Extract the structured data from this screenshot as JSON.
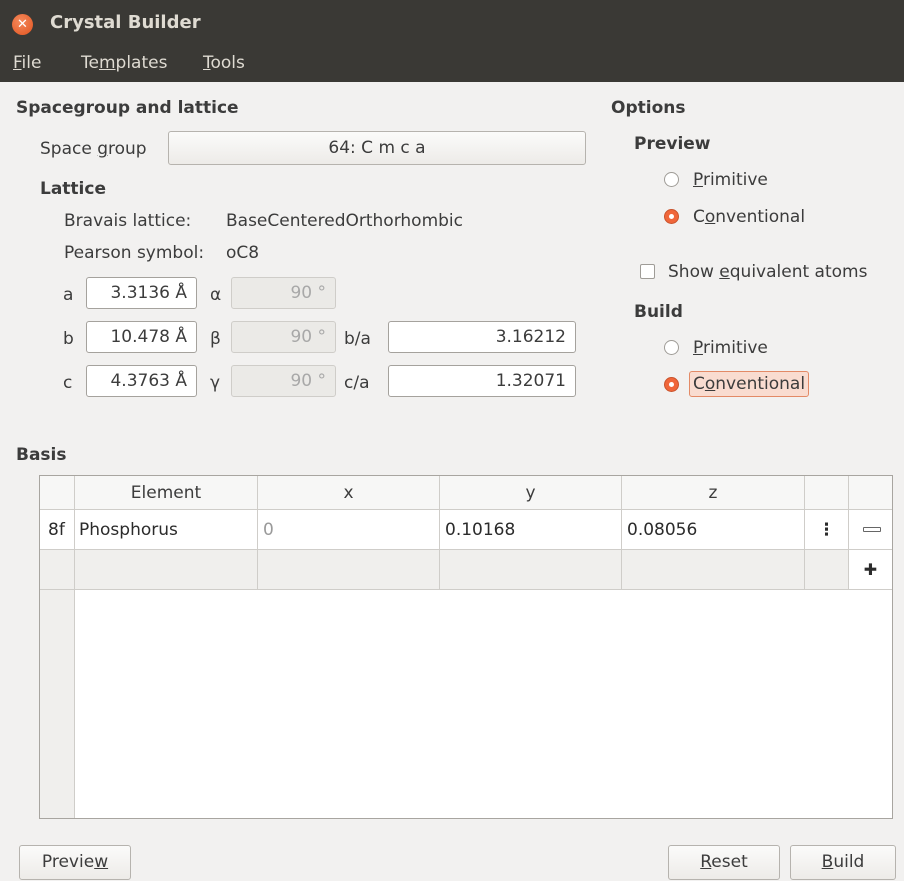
{
  "window": {
    "title": "Crystal Builder"
  },
  "menu": [
    {
      "label": "File",
      "mnemonic": "F",
      "rest": "ile"
    },
    {
      "label": "Templates",
      "pre": "Te",
      "mnemonic": "m",
      "rest": "plates"
    },
    {
      "label": "Tools",
      "mnemonic": "T",
      "rest": "ools"
    }
  ],
  "spacegroup": {
    "section_title": "Spacegroup and lattice",
    "space_group_label_pre": "Space ",
    "space_group_label_mn": "g",
    "space_group_label_post": "roup",
    "space_group_value": "64: C m c a",
    "lattice_title": "Lattice",
    "bravais_label": "Bravais lattice:",
    "bravais_value": "BaseCenteredOrthorhombic",
    "pearson_label": "Pearson symbol:",
    "pearson_value": "oC8",
    "params": {
      "a_label": "a",
      "a_value": "3.3136 Å",
      "alpha_label": "α",
      "alpha_value": "90 °",
      "b_label": "b",
      "b_value": "10.478 Å",
      "beta_label": "β",
      "beta_value": "90 °",
      "c_label": "c",
      "c_value": "4.3763 Å",
      "gamma_label": "γ",
      "gamma_value": "90 °",
      "ba_label": "b/a",
      "ba_value": "3.16212",
      "ca_label": "c/a",
      "ca_value": "1.32071"
    }
  },
  "options": {
    "title": "Options",
    "preview_title": "Preview",
    "preview_primitive": {
      "mn": "P",
      "rest": "rimitive",
      "selected": false
    },
    "preview_conventional": {
      "pre": "C",
      "mn": "o",
      "rest": "nventional",
      "selected": true
    },
    "show_equiv": {
      "pre": "Show ",
      "mn": "e",
      "rest": "quivalent atoms",
      "checked": false
    },
    "build_title": "Build",
    "build_primitive": {
      "mn": "P",
      "rest": "rimitive",
      "selected": false
    },
    "build_conventional": {
      "pre": "C",
      "mn": "o",
      "rest": "nventional",
      "selected": true
    }
  },
  "basis": {
    "title": "Basis",
    "columns": [
      "Element",
      "x",
      "y",
      "z"
    ],
    "rows": [
      {
        "wyckoff": "8f",
        "element": "Phosphorus",
        "x": "0",
        "y": "0.10168",
        "z": "0.08056"
      }
    ]
  },
  "buttons": {
    "preview": {
      "pre": "Previe",
      "mn": "w",
      "rest": ""
    },
    "reset": {
      "pre": "",
      "mn": "R",
      "rest": "eset"
    },
    "build": {
      "pre": "",
      "mn": "B",
      "rest": "uild"
    }
  },
  "colors": {
    "titlebar": "#3a3935",
    "accent": "#f0663a",
    "window_bg": "#f2f1f0"
  }
}
